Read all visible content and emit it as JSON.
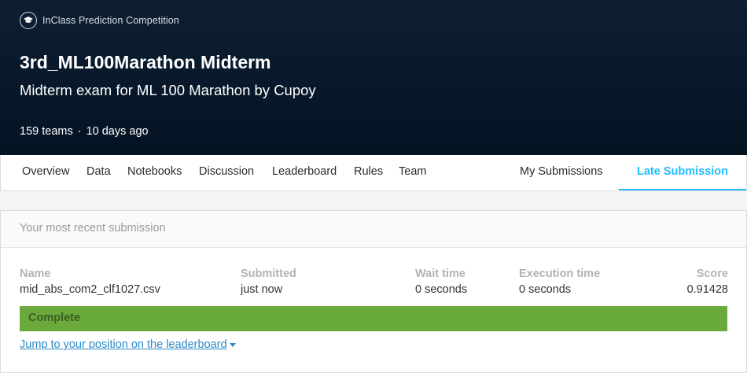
{
  "competition": {
    "badge_label": "InClass Prediction Competition",
    "title": "3rd_ML100Marathon Midterm",
    "subtitle": "Midterm exam for ML 100 Marathon by Cupoy",
    "teams": "159 teams",
    "separator": "·",
    "age": "10 days ago"
  },
  "tabs": {
    "overview": "Overview",
    "data": "Data",
    "notebooks": "Notebooks",
    "discussion": "Discussion",
    "leaderboard": "Leaderboard",
    "rules": "Rules",
    "team": "Team",
    "my_submissions": "My Submissions",
    "late_submission": "Late Submission",
    "active": "Late Submission"
  },
  "submission": {
    "header": "Your most recent submission",
    "columns": {
      "name": "Name",
      "submitted": "Submitted",
      "wait_time": "Wait time",
      "execution_time": "Execution time",
      "score": "Score"
    },
    "values": {
      "name": "mid_abs_com2_clf1027.csv",
      "submitted": "just now",
      "wait_time": "0 seconds",
      "execution_time": "0 seconds",
      "score": "0.91428"
    },
    "status": "Complete",
    "jump_link": "Jump to your position on the leaderboard"
  },
  "colors": {
    "accent": "#20beff",
    "status_complete": "#6aaa3c",
    "hero_bg": "#08182a"
  }
}
